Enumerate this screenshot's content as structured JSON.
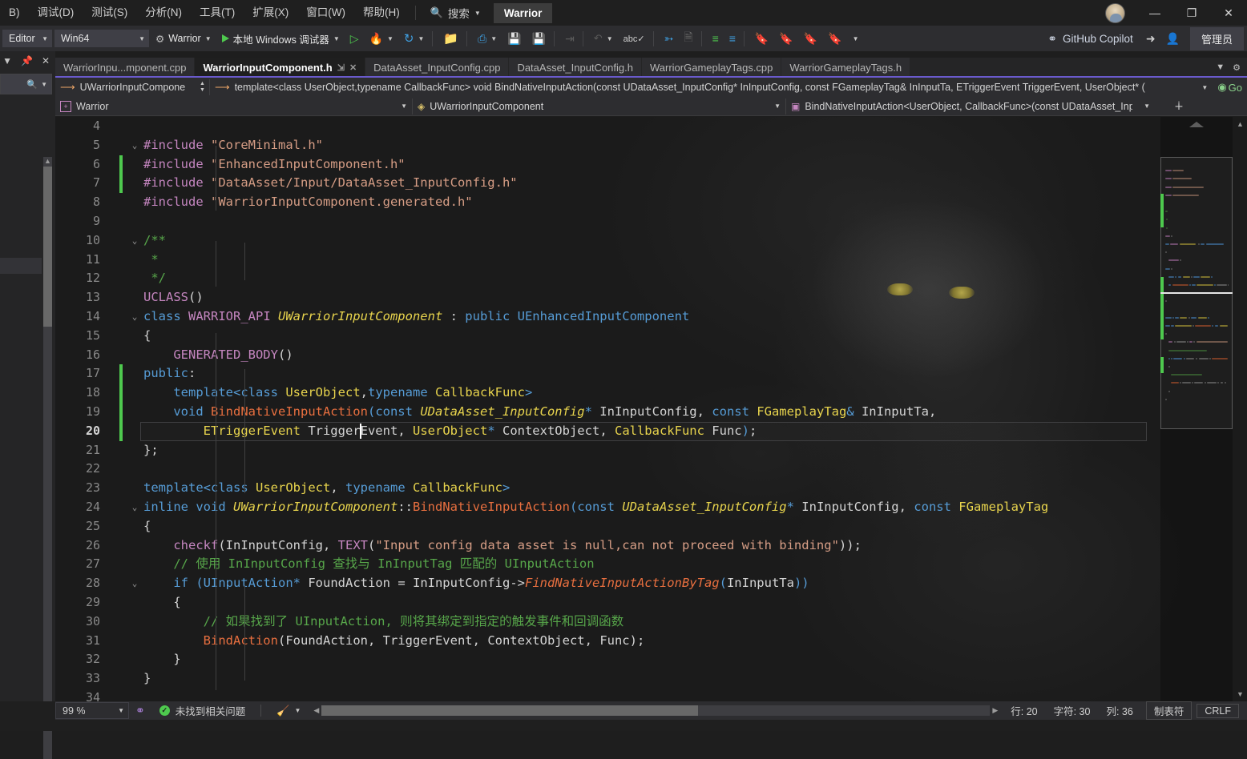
{
  "titlebar": {
    "menus": [
      "B)",
      "调试(D)",
      "测试(S)",
      "分析(N)",
      "工具(T)",
      "扩展(X)",
      "窗口(W)",
      "帮助(H)"
    ],
    "search_label": "搜索",
    "search_icon": "search-icon",
    "project_name": "Warrior",
    "minimize": "—",
    "restore": "❐",
    "close": "✕"
  },
  "toolbar": {
    "config": "Editor",
    "platform": "Win64",
    "startup_project": "Warrior",
    "run_label": "本地 Windows 调试器",
    "copilot_label": "GitHub Copilot",
    "admin_label": "管理员"
  },
  "leftdock": {
    "dropdown_icon": "chevron-down-icon",
    "pin_icon": "pin-icon",
    "close_icon": "close-icon",
    "search_icon": "search-icon"
  },
  "tabs": [
    {
      "label": "WarriorInpu...mponent.cpp",
      "active": false,
      "pinned": false
    },
    {
      "label": "WarriorInputComponent.h",
      "active": true,
      "pinned": true
    },
    {
      "label": "DataAsset_InputConfig.cpp",
      "active": false,
      "pinned": false
    },
    {
      "label": "DataAsset_InputConfig.h",
      "active": false,
      "pinned": false
    },
    {
      "label": "WarriorGameplayTags.cpp",
      "active": false,
      "pinned": false
    },
    {
      "label": "WarriorGameplayTags.h",
      "active": false,
      "pinned": false
    }
  ],
  "navbar": {
    "row1": {
      "scope": "UWarriorInputCompone",
      "signature": "template<class UserObject,typename CallbackFunc> void BindNativeInputAction(const UDataAsset_InputConfig* InInputConfig, const FGameplayTag& InInputTa, ETriggerEvent TriggerEvent, UserObject* (",
      "go_label": "Go"
    },
    "row2": {
      "project": "Warrior",
      "class": "UWarriorInputComponent",
      "member": "BindNativeInputAction<UserObject, CallbackFunc>(const UDataAsset_Inp"
    }
  },
  "editor": {
    "first_line": 4,
    "current_line": 20,
    "lines": [
      {
        "n": 4,
        "tokens": [],
        "fold": "",
        "change": false
      },
      {
        "n": 5,
        "fold": "v",
        "change": false,
        "tokens": [
          {
            "t": "#include ",
            "c": "pp"
          },
          {
            "t": "\"CoreMinimal.h\"",
            "c": "str"
          }
        ]
      },
      {
        "n": 6,
        "fold": "",
        "change": true,
        "tokens": [
          {
            "t": "#include ",
            "c": "pp"
          },
          {
            "t": "\"EnhancedInputComponent.h\"",
            "c": "str"
          }
        ]
      },
      {
        "n": 7,
        "fold": "",
        "change": true,
        "tokens": [
          {
            "t": "#include ",
            "c": "pp"
          },
          {
            "t": "\"DataAsset/Input/DataAsset_InputConfig.h\"",
            "c": "str"
          }
        ]
      },
      {
        "n": 8,
        "fold": "",
        "change": false,
        "tokens": [
          {
            "t": "#include ",
            "c": "pp"
          },
          {
            "t": "\"WarriorInputComponent.generated.h\"",
            "c": "str"
          }
        ]
      },
      {
        "n": 9,
        "fold": "",
        "change": false,
        "tokens": []
      },
      {
        "n": 10,
        "fold": "v",
        "change": false,
        "tokens": [
          {
            "t": "/**",
            "c": "cm"
          }
        ]
      },
      {
        "n": 11,
        "fold": "",
        "change": false,
        "tokens": [
          {
            "t": " *",
            "c": "cm"
          }
        ]
      },
      {
        "n": 12,
        "fold": "",
        "change": false,
        "tokens": [
          {
            "t": " */",
            "c": "cm"
          }
        ]
      },
      {
        "n": 13,
        "fold": "",
        "change": false,
        "tokens": [
          {
            "t": "UCLASS",
            "c": "pp"
          },
          {
            "t": "()",
            "c": "pl"
          }
        ]
      },
      {
        "n": 14,
        "fold": "v",
        "change": false,
        "tokens": [
          {
            "t": "class ",
            "c": "k"
          },
          {
            "t": "WARRIOR_API ",
            "c": "pp"
          },
          {
            "t": "UWarriorInputComponent",
            "c": "typ"
          },
          {
            "t": " : ",
            "c": "pl"
          },
          {
            "t": "public ",
            "c": "k"
          },
          {
            "t": "UEnhancedInputComponent",
            "c": "k"
          }
        ]
      },
      {
        "n": 15,
        "fold": "",
        "change": false,
        "tokens": [
          {
            "t": "{",
            "c": "pl"
          }
        ]
      },
      {
        "n": 16,
        "fold": "",
        "change": false,
        "tokens": [
          {
            "t": "    ",
            "c": "pl"
          },
          {
            "t": "GENERATED_BODY",
            "c": "pp"
          },
          {
            "t": "()",
            "c": "pl"
          }
        ]
      },
      {
        "n": 17,
        "fold": "",
        "change": true,
        "tokens": [
          {
            "t": "public",
            "c": "k"
          },
          {
            "t": ":",
            "c": "pl"
          }
        ]
      },
      {
        "n": 18,
        "fold": "",
        "change": true,
        "tokens": [
          {
            "t": "    ",
            "c": "pl"
          },
          {
            "t": "template",
            "c": "k"
          },
          {
            "t": "<",
            "c": "op"
          },
          {
            "t": "class ",
            "c": "k"
          },
          {
            "t": "UserObject",
            "c": "typ2"
          },
          {
            "t": ",",
            "c": "pl"
          },
          {
            "t": "typename ",
            "c": "k"
          },
          {
            "t": "CallbackFunc",
            "c": "typ2"
          },
          {
            "t": ">",
            "c": "op"
          }
        ]
      },
      {
        "n": 19,
        "fold": "",
        "change": true,
        "tokens": [
          {
            "t": "    ",
            "c": "pl"
          },
          {
            "t": "void ",
            "c": "k"
          },
          {
            "t": "BindNativeInputAction",
            "c": "fn"
          },
          {
            "t": "(",
            "c": "op"
          },
          {
            "t": "const ",
            "c": "k"
          },
          {
            "t": "UDataAsset_InputConfig",
            "c": "typ"
          },
          {
            "t": "* ",
            "c": "op"
          },
          {
            "t": "InInputConfig",
            "c": "pl"
          },
          {
            "t": ", ",
            "c": "pl"
          },
          {
            "t": "const ",
            "c": "k"
          },
          {
            "t": "FGameplayTag",
            "c": "typ2"
          },
          {
            "t": "&",
            "c": "op"
          },
          {
            "t": " InInputTa",
            "c": "pl"
          },
          {
            "t": ",",
            "c": "pl"
          }
        ]
      },
      {
        "n": 20,
        "fold": "",
        "change": true,
        "current": true,
        "tokens": [
          {
            "t": "        ",
            "c": "pl"
          },
          {
            "t": "ETriggerEvent",
            "c": "typ2"
          },
          {
            "t": " TriggerEvent",
            "c": "pl"
          },
          {
            "t": ",",
            "c": "pl"
          },
          {
            "t": " UserObject",
            "c": "typ2"
          },
          {
            "t": "* ",
            "c": "op"
          },
          {
            "t": "ContextObject",
            "c": "pl"
          },
          {
            "t": ", ",
            "c": "pl"
          },
          {
            "t": "CallbackFunc",
            "c": "typ2"
          },
          {
            "t": " Func",
            "c": "pl"
          },
          {
            "t": ")",
            "c": "op"
          },
          {
            "t": ";",
            "c": "pl"
          }
        ]
      },
      {
        "n": 21,
        "fold": "",
        "change": false,
        "tokens": [
          {
            "t": "};",
            "c": "pl"
          }
        ]
      },
      {
        "n": 22,
        "fold": "",
        "change": false,
        "tokens": []
      },
      {
        "n": 23,
        "fold": "",
        "change": false,
        "tokens": [
          {
            "t": "template",
            "c": "k"
          },
          {
            "t": "<",
            "c": "op"
          },
          {
            "t": "class ",
            "c": "k"
          },
          {
            "t": "UserObject",
            "c": "typ2"
          },
          {
            "t": ", ",
            "c": "pl"
          },
          {
            "t": "typename ",
            "c": "k"
          },
          {
            "t": "CallbackFunc",
            "c": "typ2"
          },
          {
            "t": ">",
            "c": "op"
          }
        ]
      },
      {
        "n": 24,
        "fold": "v",
        "change": false,
        "tokens": [
          {
            "t": "inline ",
            "c": "k"
          },
          {
            "t": "void ",
            "c": "k"
          },
          {
            "t": "UWarriorInputComponent",
            "c": "typ"
          },
          {
            "t": "::",
            "c": "pl"
          },
          {
            "t": "BindNativeInputAction",
            "c": "fn"
          },
          {
            "t": "(",
            "c": "op"
          },
          {
            "t": "const ",
            "c": "k"
          },
          {
            "t": "UDataAsset_InputConfig",
            "c": "typ"
          },
          {
            "t": "* ",
            "c": "op"
          },
          {
            "t": "InInputConfig",
            "c": "pl"
          },
          {
            "t": ", ",
            "c": "pl"
          },
          {
            "t": "const ",
            "c": "k"
          },
          {
            "t": "FGameplayTag",
            "c": "typ2"
          }
        ]
      },
      {
        "n": 25,
        "fold": "",
        "change": false,
        "tokens": [
          {
            "t": "{",
            "c": "pl"
          }
        ]
      },
      {
        "n": 26,
        "fold": "",
        "change": false,
        "tokens": [
          {
            "t": "    ",
            "c": "pl"
          },
          {
            "t": "checkf",
            "c": "pp"
          },
          {
            "t": "(",
            "c": "pl"
          },
          {
            "t": "InInputConfig",
            "c": "pl"
          },
          {
            "t": ", ",
            "c": "pl"
          },
          {
            "t": "TEXT",
            "c": "pp"
          },
          {
            "t": "(",
            "c": "pl"
          },
          {
            "t": "\"Input config data asset is null,can not proceed with binding\"",
            "c": "str"
          },
          {
            "t": "));",
            "c": "pl"
          }
        ]
      },
      {
        "n": 27,
        "fold": "",
        "change": false,
        "tokens": [
          {
            "t": "    // 使用 InInputConfig 查找与 InInputTag 匹配的 UInputAction",
            "c": "cm"
          }
        ]
      },
      {
        "n": 28,
        "fold": "v",
        "change": false,
        "tokens": [
          {
            "t": "    ",
            "c": "pl"
          },
          {
            "t": "if ",
            "c": "k"
          },
          {
            "t": "(",
            "c": "op"
          },
          {
            "t": "UInputAction",
            "c": "k"
          },
          {
            "t": "* ",
            "c": "op"
          },
          {
            "t": "FoundAction",
            "c": "pl"
          },
          {
            "t": " = ",
            "c": "pl"
          },
          {
            "t": "InInputConfig",
            "c": "pl"
          },
          {
            "t": "->",
            "c": "pl"
          },
          {
            "t": "FindNativeInputActionByTag",
            "c": "fnI"
          },
          {
            "t": "(",
            "c": "op"
          },
          {
            "t": "InInputTa",
            "c": "pl"
          },
          {
            "t": "))",
            "c": "op"
          }
        ]
      },
      {
        "n": 29,
        "fold": "",
        "change": false,
        "tokens": [
          {
            "t": "    {",
            "c": "pl"
          }
        ]
      },
      {
        "n": 30,
        "fold": "",
        "change": false,
        "tokens": [
          {
            "t": "        // 如果找到了 UInputAction, 则将其绑定到指定的触发事件和回调函数",
            "c": "cm"
          }
        ]
      },
      {
        "n": 31,
        "fold": "",
        "change": false,
        "tokens": [
          {
            "t": "        ",
            "c": "pl"
          },
          {
            "t": "BindAction",
            "c": "fn"
          },
          {
            "t": "(",
            "c": "pl"
          },
          {
            "t": "FoundAction",
            "c": "pl"
          },
          {
            "t": ", ",
            "c": "pl"
          },
          {
            "t": "TriggerEvent",
            "c": "pl"
          },
          {
            "t": ", ",
            "c": "pl"
          },
          {
            "t": "ContextObject",
            "c": "pl"
          },
          {
            "t": ", ",
            "c": "pl"
          },
          {
            "t": "Func",
            "c": "pl"
          },
          {
            "t": ");",
            "c": "pl"
          }
        ]
      },
      {
        "n": 32,
        "fold": "",
        "change": false,
        "tokens": [
          {
            "t": "    }",
            "c": "pl"
          }
        ]
      },
      {
        "n": 33,
        "fold": "",
        "change": false,
        "tokens": [
          {
            "t": "}",
            "c": "pl"
          }
        ]
      },
      {
        "n": 34,
        "fold": "",
        "change": false,
        "tokens": []
      }
    ]
  },
  "statusbar": {
    "zoom": "99 %",
    "problem_status": "未找到相关问题",
    "line_label": "行: 20",
    "char_label": "字符: 30",
    "col_label": "列: 36",
    "tabs_label": "制表符",
    "eol_label": "CRLF"
  },
  "colors": {
    "accent": "#6a5acd",
    "ok_green": "#4ec94e",
    "change_green": "#4ec94e",
    "string": "#d69d85",
    "keyword": "#569cd6",
    "comment": "#57a64a",
    "type": "#e8d44d",
    "function": "#e86f3f",
    "macro": "#c586c0"
  }
}
